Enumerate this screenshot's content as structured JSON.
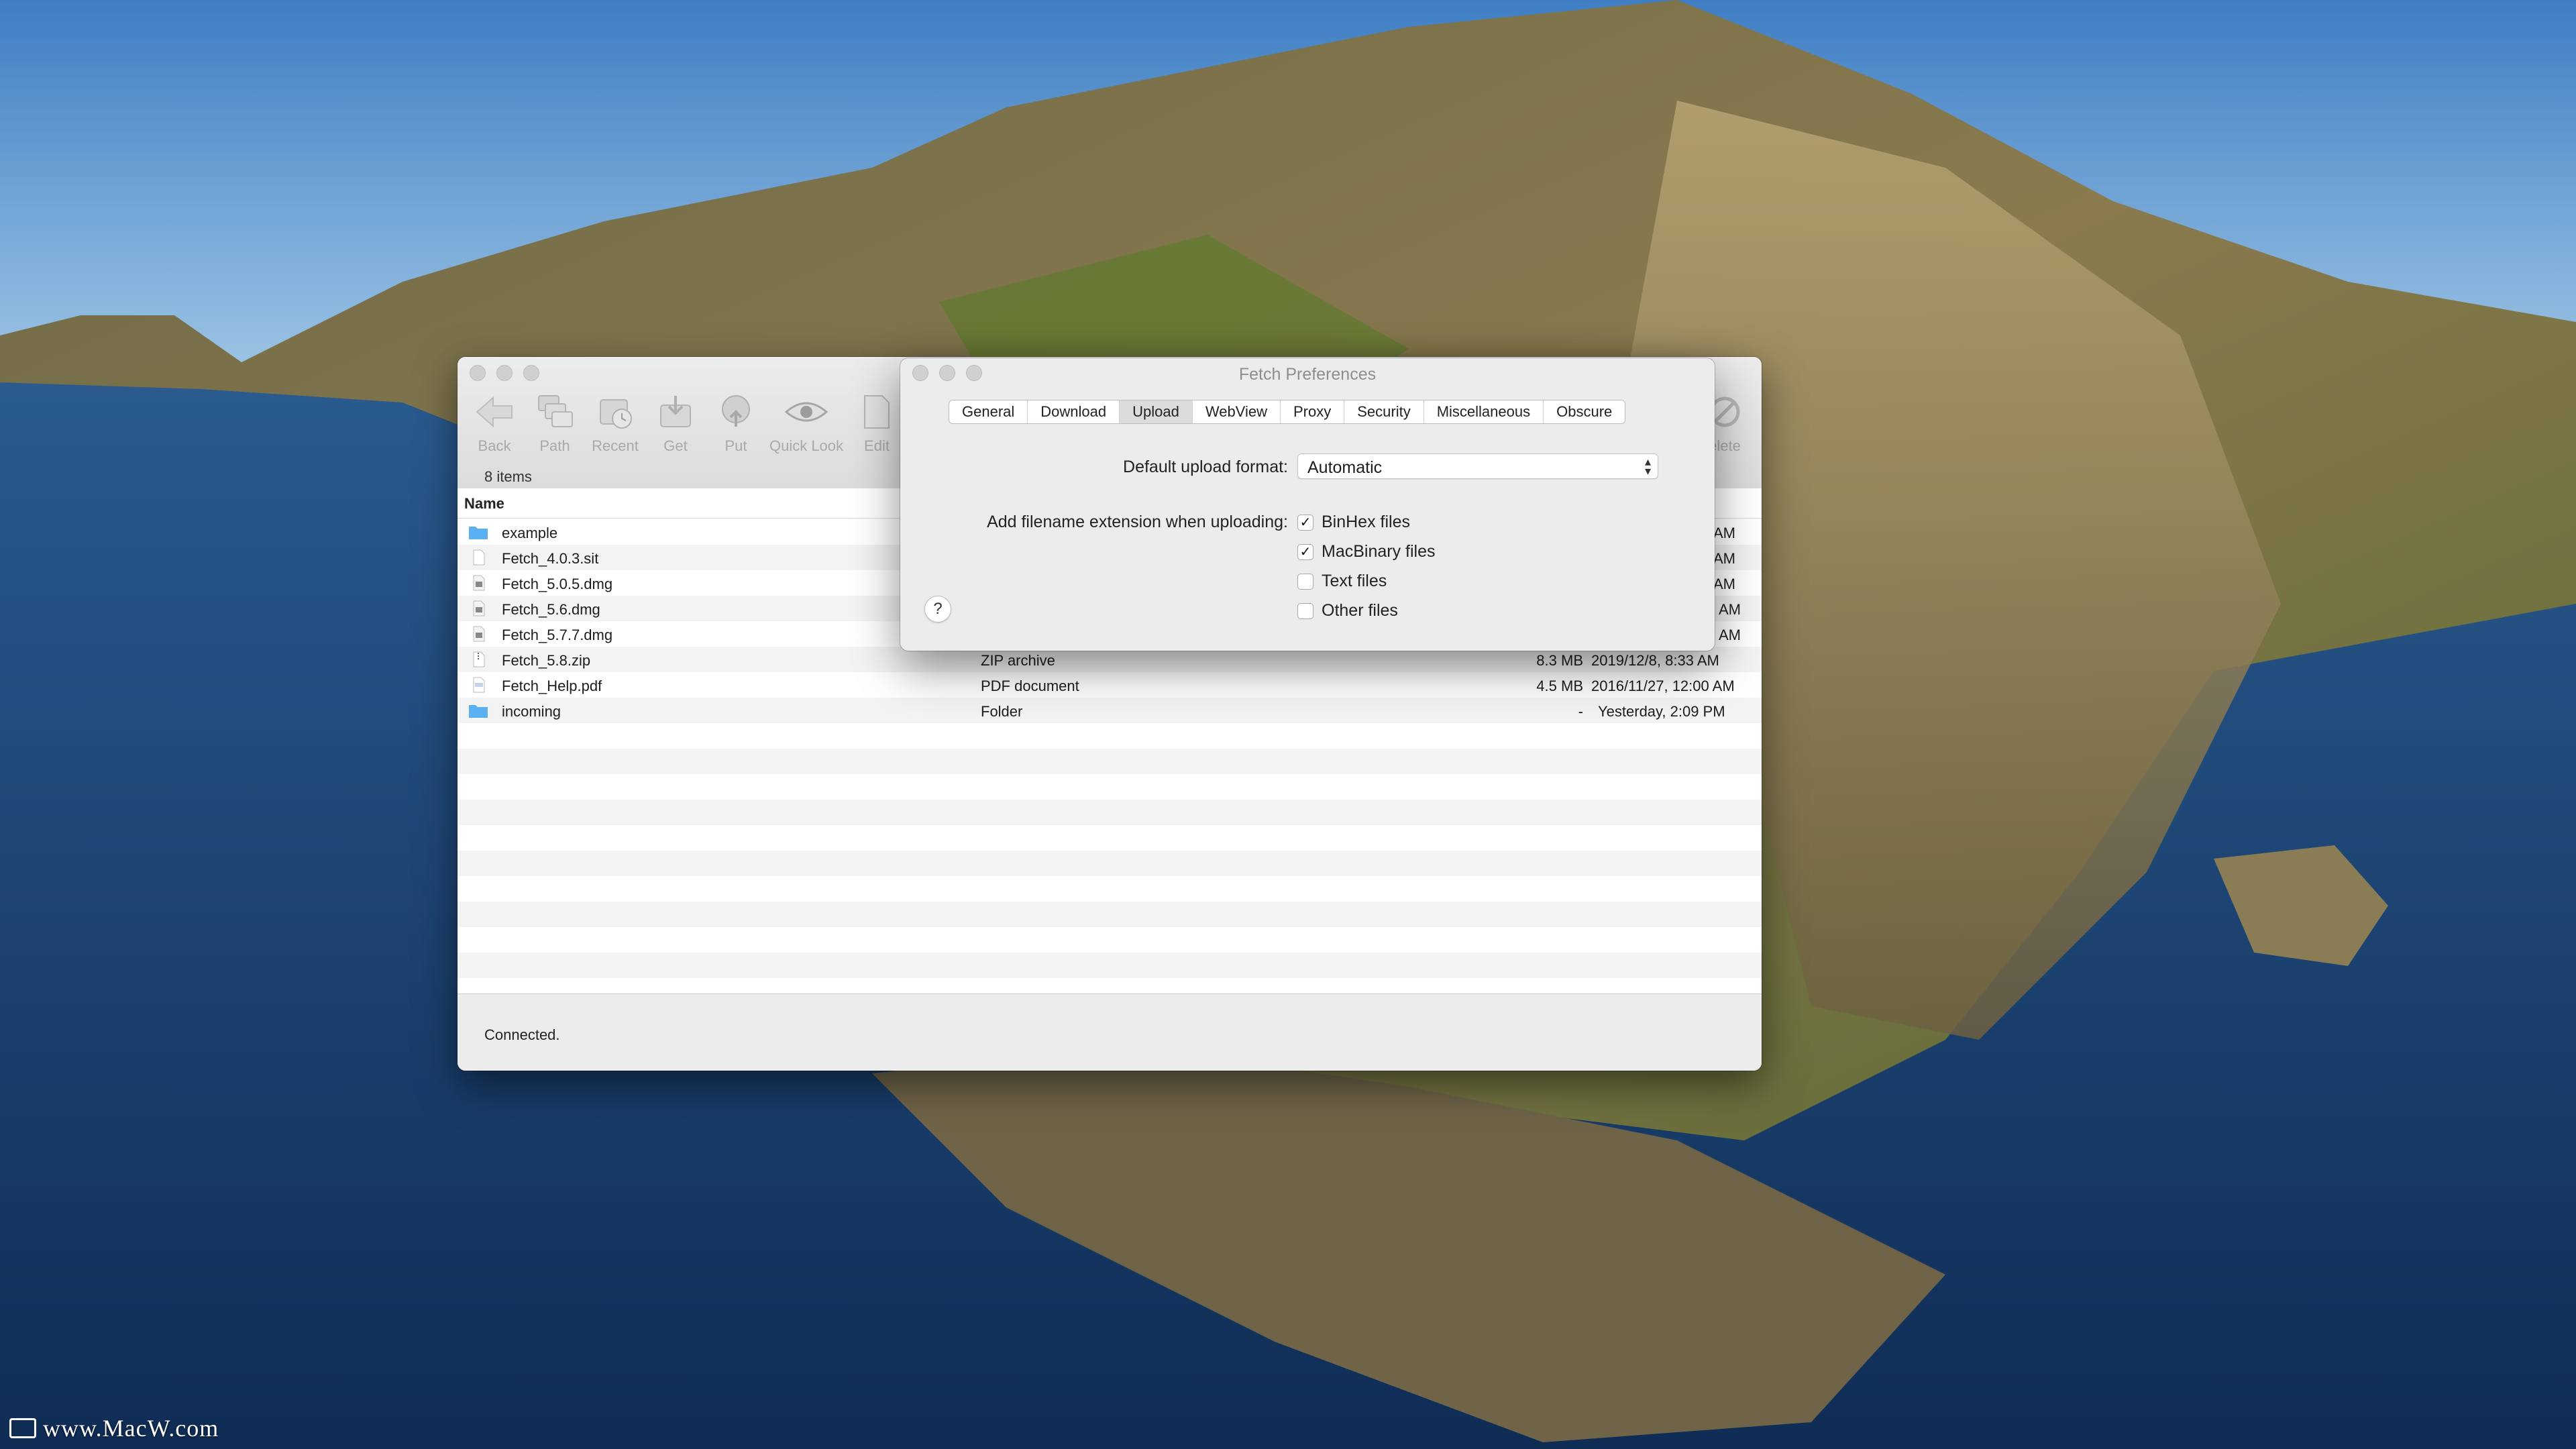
{
  "watermark": {
    "text": "www.MacW.com"
  },
  "fetch_window": {
    "toolbar": [
      {
        "label": "Back",
        "icon": "back-arrow-icon"
      },
      {
        "label": "Path",
        "icon": "path-folders-icon"
      },
      {
        "label": "Recent",
        "icon": "recent-clock-icon"
      },
      {
        "label": "Get",
        "icon": "get-download-icon"
      },
      {
        "label": "Put",
        "icon": "put-upload-icon"
      },
      {
        "label": "Quick Look",
        "icon": "eye-icon"
      },
      {
        "label": "Edit",
        "icon": "edit-document-icon"
      }
    ],
    "toolbar_right": {
      "label": "elete",
      "icon": "delete-icon"
    },
    "item_count": "8 items",
    "column_name": "Name",
    "files": [
      {
        "name": "example",
        "kind": "",
        "size": "",
        "date": "AM",
        "icon": "folder-icon"
      },
      {
        "name": "Fetch_4.0.3.sit",
        "kind": "",
        "size": "",
        "date": "AM",
        "icon": "document-icon"
      },
      {
        "name": "Fetch_5.0.5.dmg",
        "kind": "",
        "size": "",
        "date": "AM",
        "icon": "disk-image-icon"
      },
      {
        "name": "Fetch_5.6.dmg",
        "kind": "",
        "size": "",
        "date": "AM",
        "icon": "disk-image-icon"
      },
      {
        "name": "Fetch_5.7.7.dmg",
        "kind": "",
        "size": "",
        "date": "AM",
        "icon": "disk-image-icon"
      },
      {
        "name": "Fetch_5.8.zip",
        "kind": "ZIP archive",
        "size": "8.3 MB",
        "date": "2019/12/8, 8:33 AM",
        "icon": "zip-icon"
      },
      {
        "name": "Fetch_Help.pdf",
        "kind": "PDF document",
        "size": "4.5 MB",
        "date": "2016/11/27, 12:00 AM",
        "icon": "pdf-icon"
      },
      {
        "name": "incoming",
        "kind": "Folder",
        "size": "-",
        "date": "Yesterday, 2:09 PM",
        "icon": "folder-icon"
      }
    ],
    "status": "Connected."
  },
  "prefs": {
    "title": "Fetch Preferences",
    "tabs": [
      "General",
      "Download",
      "Upload",
      "WebView",
      "Proxy",
      "Security",
      "Miscellaneous",
      "Obscure"
    ],
    "active_tab": "Upload",
    "format_label": "Default upload format:",
    "format_value": "Automatic",
    "extension_label": "Add filename extension when uploading:",
    "checkboxes": [
      {
        "label": "BinHex files",
        "checked": true
      },
      {
        "label": "MacBinary files",
        "checked": true
      },
      {
        "label": "Text files",
        "checked": false
      },
      {
        "label": "Other files",
        "checked": false
      }
    ],
    "help": "?"
  },
  "colors": {
    "folder": "#5ab0f0",
    "toolbar_disabled": "#a9a9a9",
    "window_bg": "#ececec"
  }
}
